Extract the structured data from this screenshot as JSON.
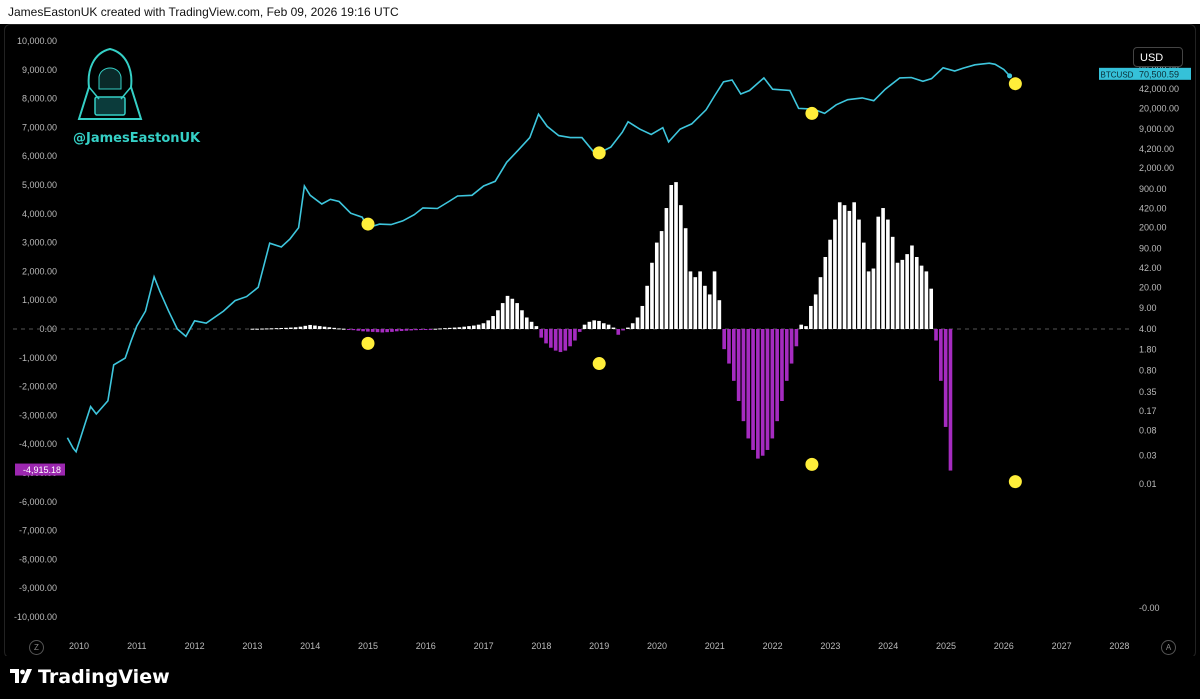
{
  "header": {
    "text": "JamesEastonUK created with TradingView.com, Feb 09, 2026 19:16 UTC"
  },
  "currency": "USD",
  "watermark": {
    "handle": "@JamesEastonUK",
    "icon": "hooded-hacker-icon"
  },
  "footer": {
    "brand": "TradingView"
  },
  "buttons": {
    "zoom": "Z",
    "auto": "A"
  },
  "colors": {
    "price_line": "#3ec6dd",
    "positive_bar": "#ffffff",
    "negative_bar": "#a52bc0",
    "marker": "#ffee3a",
    "price_badge": "#35c1d9",
    "value_badge": "#9c27b0"
  },
  "chart_data": {
    "type": "bar",
    "left_axis": {
      "ticks": [
        "10,000.00",
        "9,000.00",
        "8,000.00",
        "7,000.00",
        "6,000.00",
        "5,000.00",
        "4,000.00",
        "3,000.00",
        "2,000.00",
        "1,000.00",
        "0.00",
        "-1,000.00",
        "-2,000.00",
        "-3,000.00",
        "-4,000.00",
        "-5,000.00",
        "-6,000.00",
        "-7,000.00",
        "-8,000.00",
        "-9,000.00",
        "-10,000.00"
      ],
      "range": [
        -10000,
        10000
      ]
    },
    "right_axis": {
      "scale": "log",
      "ticks": [
        "90,000.00",
        "42,000.00",
        "20,000.00",
        "9,000.00",
        "4,200.00",
        "2,000.00",
        "900.00",
        "420.00",
        "200.00",
        "90.00",
        "42.00",
        "20.00",
        "9.00",
        "4.00",
        "1.80",
        "0.80",
        "0.35",
        "0.17",
        "0.08",
        "0.03",
        "0.01",
        "-0.00"
      ]
    },
    "x_axis": {
      "ticks": [
        "2010",
        "2011",
        "2012",
        "2013",
        "2014",
        "2015",
        "2016",
        "2017",
        "2018",
        "2019",
        "2020",
        "2021",
        "2022",
        "2023",
        "2024",
        "2025",
        "2026",
        "2027",
        "2028"
      ]
    },
    "current_value_label": "-4,915.18",
    "price_label": {
      "symbol": "BTCUSD",
      "value": "70,500.59"
    },
    "price_series": {
      "name": "BTCUSD",
      "points": [
        [
          2009.8,
          0.06
        ],
        [
          2009.9,
          0.04
        ],
        [
          2009.95,
          0.035
        ],
        [
          2010.1,
          0.1
        ],
        [
          2010.2,
          0.2
        ],
        [
          2010.3,
          0.15
        ],
        [
          2010.5,
          0.25
        ],
        [
          2010.6,
          1.0
        ],
        [
          2010.8,
          1.3
        ],
        [
          2010.9,
          2.5
        ],
        [
          2011.0,
          4.5
        ],
        [
          2011.15,
          8.0
        ],
        [
          2011.3,
          30
        ],
        [
          2011.4,
          17
        ],
        [
          2011.55,
          8
        ],
        [
          2011.7,
          4
        ],
        [
          2011.85,
          3
        ],
        [
          2012.0,
          5.5
        ],
        [
          2012.2,
          5
        ],
        [
          2012.5,
          8
        ],
        [
          2012.7,
          12
        ],
        [
          2012.9,
          14
        ],
        [
          2013.1,
          20
        ],
        [
          2013.3,
          110
        ],
        [
          2013.5,
          95
        ],
        [
          2013.65,
          130
        ],
        [
          2013.8,
          200
        ],
        [
          2013.9,
          1000
        ],
        [
          2014.0,
          700
        ],
        [
          2014.2,
          500
        ],
        [
          2014.35,
          600
        ],
        [
          2014.5,
          550
        ],
        [
          2014.7,
          350
        ],
        [
          2014.9,
          300
        ],
        [
          2015.0,
          200
        ],
        [
          2015.2,
          230
        ],
        [
          2015.4,
          225
        ],
        [
          2015.6,
          260
        ],
        [
          2015.8,
          330
        ],
        [
          2015.95,
          430
        ],
        [
          2016.2,
          420
        ],
        [
          2016.4,
          550
        ],
        [
          2016.55,
          680
        ],
        [
          2016.8,
          700
        ],
        [
          2017.0,
          1000
        ],
        [
          2017.2,
          1200
        ],
        [
          2017.4,
          2500
        ],
        [
          2017.6,
          4000
        ],
        [
          2017.8,
          6500
        ],
        [
          2017.95,
          16000
        ],
        [
          2018.1,
          10000
        ],
        [
          2018.3,
          7000
        ],
        [
          2018.5,
          6500
        ],
        [
          2018.7,
          6500
        ],
        [
          2018.9,
          3800
        ],
        [
          2019.0,
          3600
        ],
        [
          2019.2,
          4500
        ],
        [
          2019.4,
          8000
        ],
        [
          2019.5,
          12000
        ],
        [
          2019.7,
          9000
        ],
        [
          2019.9,
          7300
        ],
        [
          2020.1,
          9500
        ],
        [
          2020.2,
          5500
        ],
        [
          2020.4,
          9000
        ],
        [
          2020.6,
          11000
        ],
        [
          2020.85,
          19000
        ],
        [
          2021.0,
          33000
        ],
        [
          2021.15,
          56000
        ],
        [
          2021.3,
          60000
        ],
        [
          2021.45,
          35000
        ],
        [
          2021.6,
          40000
        ],
        [
          2021.85,
          65000
        ],
        [
          2022.0,
          42000
        ],
        [
          2022.3,
          40000
        ],
        [
          2022.45,
          20000
        ],
        [
          2022.7,
          19500
        ],
        [
          2022.9,
          16500
        ],
        [
          2023.1,
          23000
        ],
        [
          2023.3,
          28000
        ],
        [
          2023.55,
          30000
        ],
        [
          2023.75,
          27000
        ],
        [
          2023.95,
          42000
        ],
        [
          2024.2,
          65000
        ],
        [
          2024.4,
          66000
        ],
        [
          2024.6,
          57000
        ],
        [
          2024.75,
          63000
        ],
        [
          2024.95,
          96000
        ],
        [
          2025.15,
          85000
        ],
        [
          2025.3,
          95000
        ],
        [
          2025.5,
          108000
        ],
        [
          2025.75,
          115000
        ],
        [
          2025.85,
          110000
        ],
        [
          2026.0,
          90000
        ],
        [
          2026.1,
          70500
        ]
      ]
    },
    "indicator_series": {
      "name": "",
      "x_start": 2010.0,
      "x_step": 0.0833,
      "values": [
        0,
        0,
        0,
        0,
        0,
        0,
        0,
        0,
        0,
        0,
        0,
        0,
        0,
        0,
        0,
        0,
        0,
        0,
        0,
        0,
        0,
        0,
        0,
        0,
        0,
        0,
        0,
        0,
        0,
        0,
        0,
        0,
        0,
        0,
        0,
        0,
        10,
        10,
        15,
        20,
        25,
        30,
        35,
        40,
        50,
        60,
        80,
        110,
        140,
        120,
        100,
        80,
        60,
        40,
        20,
        10,
        -20,
        -40,
        -60,
        -80,
        -90,
        -100,
        -110,
        -120,
        -110,
        -100,
        -80,
        -70,
        -60,
        -50,
        -40,
        -30,
        -20,
        -10,
        10,
        20,
        30,
        40,
        50,
        60,
        80,
        100,
        120,
        150,
        200,
        300,
        450,
        650,
        900,
        1150,
        1050,
        900,
        650,
        400,
        250,
        100,
        -300,
        -500,
        -650,
        -750,
        -800,
        -750,
        -600,
        -400,
        -100,
        150,
        250,
        300,
        280,
        200,
        150,
        50,
        -200,
        -50,
        50,
        200,
        400,
        800,
        1500,
        2300,
        3000,
        3400,
        4200,
        5000,
        5100,
        4300,
        3500,
        2000,
        1800,
        2000,
        1500,
        1200,
        2000,
        1000,
        -700,
        -1200,
        -1800,
        -2500,
        -3200,
        -3800,
        -4200,
        -4500,
        -4400,
        -4200,
        -3800,
        -3200,
        -2500,
        -1800,
        -1200,
        -600,
        150,
        100,
        800,
        1200,
        1800,
        2500,
        3100,
        3800,
        4400,
        4300,
        4100,
        4400,
        3800,
        3000,
        2000,
        2100,
        3900,
        4200,
        3800,
        3200,
        2300,
        2400,
        2600,
        2900,
        2500,
        2200,
        2000,
        1400,
        -400,
        -1800,
        -3400,
        -4915
      ]
    },
    "markers": [
      [
        2015.0,
        230,
        "price"
      ],
      [
        2015.0,
        -500,
        "indicator"
      ],
      [
        2019.0,
        3600,
        "price"
      ],
      [
        2019.0,
        -1200,
        "indicator"
      ],
      [
        2022.68,
        16500,
        "price"
      ],
      [
        2022.68,
        -4700,
        "indicator"
      ],
      [
        2026.2,
        52000,
        "price"
      ],
      [
        2026.2,
        -5300,
        "indicator"
      ]
    ]
  }
}
